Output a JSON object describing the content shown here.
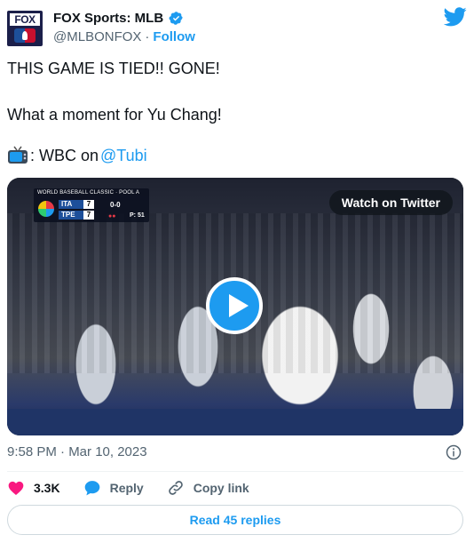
{
  "author": {
    "display_name": "FOX Sports: MLB",
    "handle": "@MLBONFOX",
    "separator": "·",
    "follow_label": "Follow",
    "avatar_text": "FOX"
  },
  "tweet": {
    "line1": "THIS GAME IS TIED!! GONE!",
    "line2": "What a moment for Yu Chang!",
    "line3_prefix": ": WBC on ",
    "line3_mention": "@Tubi"
  },
  "video": {
    "watch_label": "Watch on Twitter",
    "scorebug": {
      "title": "WORLD BASEBALL CLASSIC · POOL A",
      "team1": "ITA",
      "score1": "7",
      "team2": "TPE",
      "score2": "7",
      "count": "0-0",
      "pitch": "P: 51",
      "outs": "●●"
    }
  },
  "meta": {
    "timestamp": "9:58 PM · Mar 10, 2023"
  },
  "actions": {
    "likes": "3.3K",
    "reply_label": "Reply",
    "copy_label": "Copy link"
  },
  "footer": {
    "read_replies": "Read 45 replies"
  },
  "colors": {
    "accent": "#1d9bf0",
    "like": "#f91880",
    "muted": "#536471"
  }
}
